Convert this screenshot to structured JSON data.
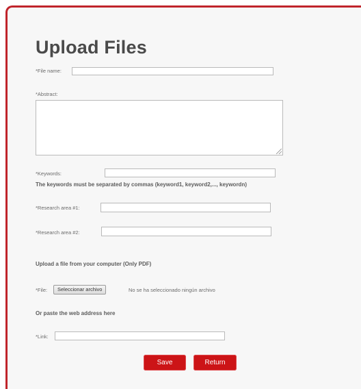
{
  "page": {
    "title": "Upload Files"
  },
  "form": {
    "file_name_label": "*File name:",
    "file_name_value": "",
    "abstract_label": "*Abstract:",
    "abstract_value": "",
    "keywords_label": "*Keywords:",
    "keywords_value": "",
    "keywords_hint": "The keywords must be separated by commas (keyword1, keyword2,..., keywordn)",
    "research_area_1_label": "*Research area #1:",
    "research_area_1_value": "",
    "research_area_2_label": "*Research area #2:",
    "research_area_2_value": "",
    "upload_heading": "Upload a file from your computer (Only PDF)",
    "file_label": "*File:",
    "choose_file_label": "Seleccionar archivo",
    "no_file_text": "No se ha seleccionado ningún archivo",
    "paste_heading": "Or paste the web address here",
    "link_label": "*Link:",
    "link_value": ""
  },
  "actions": {
    "save_label": "Save",
    "return_label": "Return"
  },
  "colors": {
    "accent": "#cc1417",
    "frame_border": "#c0242b"
  }
}
